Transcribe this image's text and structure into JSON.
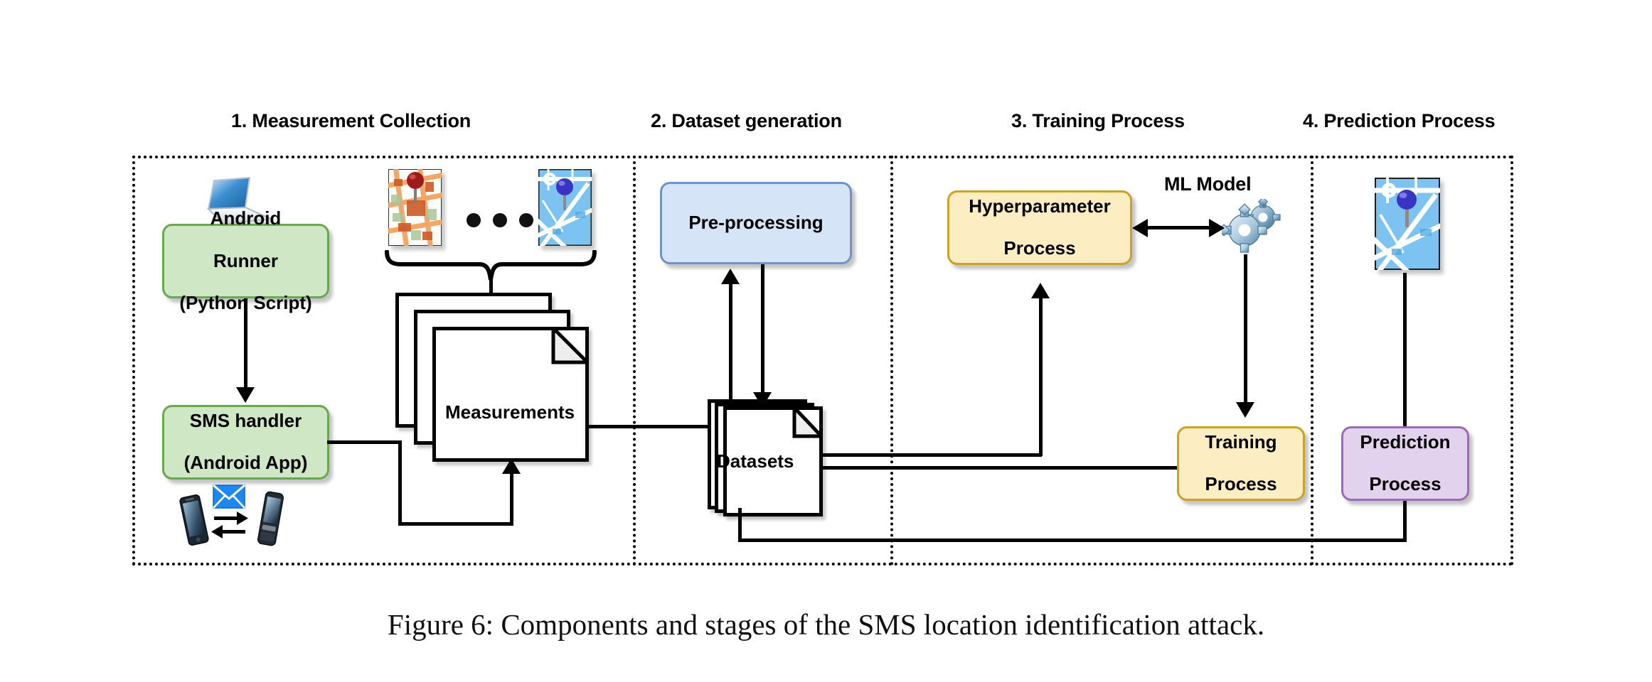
{
  "figure": {
    "caption": "Figure 6: Components and stages of the SMS location identification attack."
  },
  "sections": [
    {
      "id": "measurement-collection",
      "title": "1. Measurement Collection"
    },
    {
      "id": "dataset-generation",
      "title": "2. Dataset generation"
    },
    {
      "id": "training-process",
      "title": "3. Training Process"
    },
    {
      "id": "prediction-process",
      "title": "4. Prediction Process"
    }
  ],
  "nodes": {
    "android_runner": {
      "line1": "Android",
      "line2": "Runner",
      "line3": "(Python Script)",
      "color": "#cfe7c4"
    },
    "sms_handler": {
      "line1": "SMS handler",
      "line2": "(Android App)",
      "color": "#cfe7c4"
    },
    "measurements": {
      "label": "Measurements"
    },
    "preprocessing": {
      "label": "Pre-processing",
      "color": "#d6e4f7"
    },
    "datasets": {
      "label": "Datasets"
    },
    "hyperparameter": {
      "line1": "Hyperparameter",
      "line2": "Process",
      "color": "#fcedc2"
    },
    "ml_model": {
      "label": "ML Model"
    },
    "training": {
      "line1": "Training",
      "line2": "Process",
      "color": "#fcedc2"
    },
    "prediction": {
      "line1": "Prediction",
      "line2": "Process",
      "color": "#e3d2ee"
    }
  },
  "icons": {
    "laptop": "laptop-icon",
    "smartphone": "smartphone-icon",
    "featurephone": "feature-phone-icon",
    "envelope": "sms-envelope-icon",
    "exchange": "two-way-exchange-icon",
    "gears": "ml-gears-icon",
    "map_orange": "map-thumbnail-orange-pin",
    "map_blue": "map-thumbnail-blue-pin",
    "map_prediction": "map-thumbnail-predicted-location",
    "ellipsis": "ellipsis-dots-icon",
    "brace": "curly-brace-icon"
  },
  "colors": {
    "green_fill": "#cfe7c4",
    "green_stroke": "#6aa84f",
    "blue_fill": "#d6e4f7",
    "blue_stroke": "#6f93c4",
    "yellow_fill": "#fcedc2",
    "yellow_stroke": "#c9a227",
    "purple_fill": "#e3d2ee",
    "purple_stroke": "#9a6cb4",
    "line": "#000000"
  }
}
